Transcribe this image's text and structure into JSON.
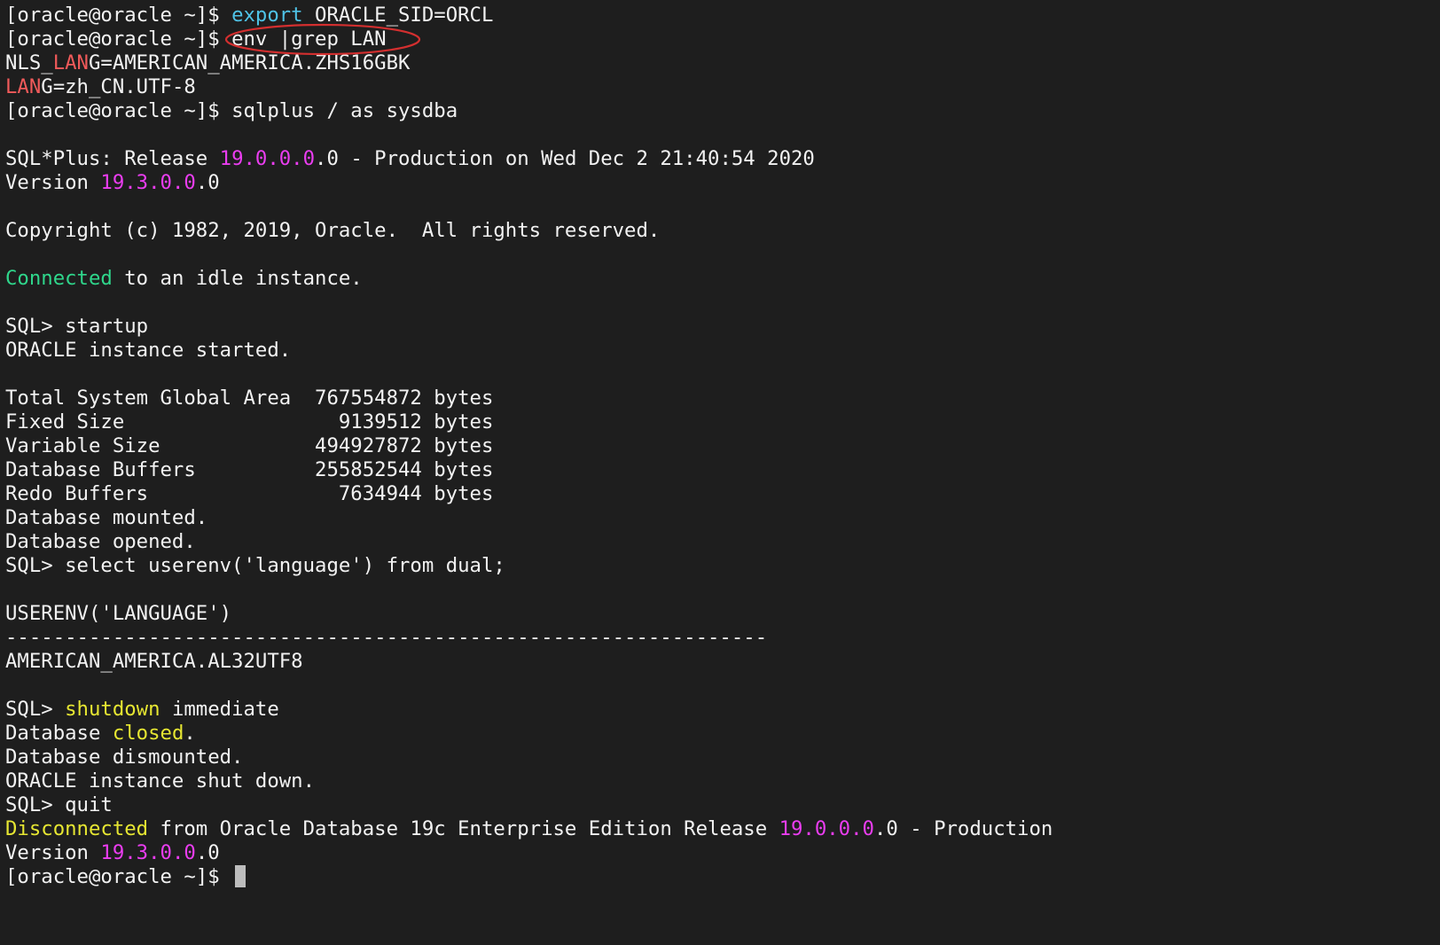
{
  "colors": {
    "background": "#1e1e1e",
    "text": "#f2f2f2",
    "cyan": "#4fc3e7",
    "red": "#f05a5a",
    "magenta": "#ea3df0",
    "green": "#2fd68b",
    "yellow": "#e6e632",
    "annotation": "#d32f2f"
  },
  "prompt": "[oracle@oracle ~]$ ",
  "l1": {
    "cmd": "export",
    "rest": " ORACLE_SID=ORCL"
  },
  "l2": {
    "cmd": "env |grep LAN"
  },
  "l3": {
    "a": "NLS_",
    "hl": "LAN",
    "b": "G=AMERICAN_AMERICA.ZHS16GBK"
  },
  "l4": {
    "hl": "LAN",
    "b": "G=zh_CN.UTF-8"
  },
  "l5": {
    "cmd": "sqlplus / as sysdba"
  },
  "l6": {
    "a": "SQL*Plus: Release ",
    "hl": "19.0.0.0",
    "b": ".0 - Production on Wed Dec 2 21:40:54 2020"
  },
  "l7": {
    "a": "Version ",
    "hl": "19.3.0.0",
    "b": ".0"
  },
  "l8": "Copyright (c) 1982, 2019, Oracle.  All rights reserved.",
  "l9": {
    "hl": "Connected",
    "b": " to an idle instance."
  },
  "sql_prompt": "SQL> ",
  "l10": "startup",
  "l11": "ORACLE instance started.",
  "sga": [
    "Total System Global Area  767554872 bytes",
    "Fixed Size                  9139512 bytes",
    "Variable Size             494927872 bytes",
    "Database Buffers          255852544 bytes",
    "Redo Buffers                7634944 bytes"
  ],
  "l17": "Database mounted.",
  "l18": "Database opened.",
  "l19": "select userenv('language') from dual;",
  "l20": "USERENV('LANGUAGE')",
  "l21": "----------------------------------------------------------------",
  "l22": "AMERICAN_AMERICA.AL32UTF8",
  "l23": {
    "hl": "shutdown",
    "b": " immediate"
  },
  "l24": {
    "a": "Database ",
    "hl": "closed",
    "b": "."
  },
  "l25": "Database dismounted.",
  "l26": "ORACLE instance shut down.",
  "l27": "quit",
  "l28": {
    "hl": "Disconnected",
    "a": " from Oracle Database 19c Enterprise Edition Release ",
    "hl2": "19.0.0.0",
    "b": ".0 - Production"
  },
  "l29": {
    "a": "Version ",
    "hl": "19.3.0.0",
    "b": ".0"
  }
}
